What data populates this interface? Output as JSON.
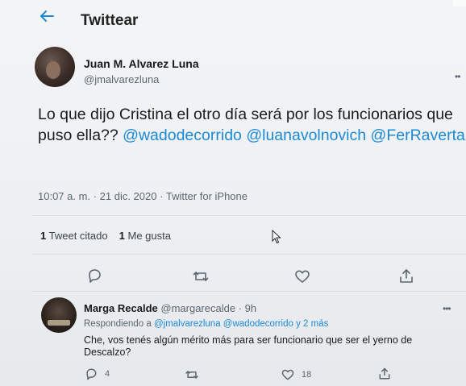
{
  "header": {
    "title": "Twittear",
    "back_icon": "arrow-left-icon"
  },
  "main_tweet": {
    "author_name": "Juan M. Alvarez Luna",
    "author_handle": "@jmalvarezluna",
    "text_prefix": "Lo que dijo Cristina el otro día será por los funcionarios que puso ella??",
    "mentions": [
      "@wadodecorrido",
      "@luanavolnovich",
      "@FerRaverta"
    ],
    "time": "10:07 a. m.",
    "date": "21 dic. 2020",
    "separator": "·",
    "source": "Twitter for iPhone",
    "stats": {
      "quote_count": "1",
      "quote_label": "Tweet citado",
      "like_count": "1",
      "like_label": "Me gusta"
    },
    "more_label": "••"
  },
  "reply": {
    "author_name": "Marga Recalde",
    "author_handle": "@margarecalde",
    "separator": "·",
    "time_ago": "9h",
    "replying_label": "Respondiendo a",
    "replying_to": "@jmalvarezluna",
    "replying_others": "@wadodecorrido y 2 más",
    "text": "Che, vos tenés algún mérito más para ser funcionario que ser el yerno de Descalzo?",
    "reply_count": "4",
    "like_count": "18",
    "more_label": "•••"
  },
  "colors": {
    "accent": "#1b8ad6",
    "text": "#1c1c1c",
    "muted": "#5b6670",
    "divider": "#d9dee3"
  }
}
